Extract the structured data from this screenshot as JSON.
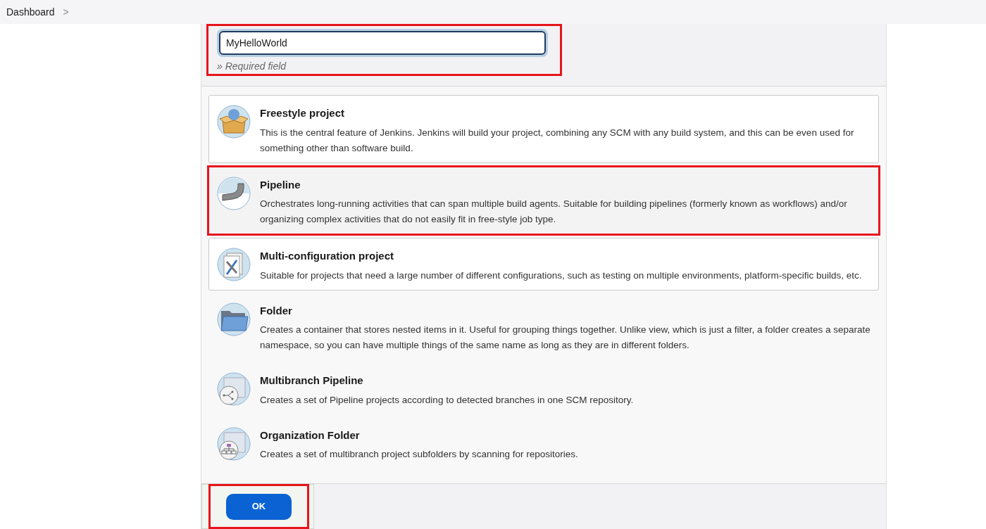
{
  "breadcrumb": {
    "label": "Dashboard",
    "separator": ">"
  },
  "name_field": {
    "value": "MyHelloWorld",
    "hint": "» Required field",
    "annotated": true
  },
  "items": [
    {
      "title": "Freestyle project",
      "description": "This is the central feature of Jenkins. Jenkins will build your project, combining any SCM with any build system, and this can be even used for something other than software build.",
      "kind": "bordered",
      "annotated": false
    },
    {
      "title": "Pipeline",
      "description": "Orchestrates long-running activities that can span multiple build agents. Suitable for building pipelines (formerly known as workflows) and/or organizing complex activities that do not easily fit in free-style job type.",
      "kind": "plain",
      "annotated": true
    },
    {
      "title": "Multi-configuration project",
      "description": "Suitable for projects that need a large number of different configurations, such as testing on multiple environments, platform-specific builds, etc.",
      "kind": "bordered",
      "annotated": false
    },
    {
      "title": "Folder",
      "description": "Creates a container that stores nested items in it. Useful for grouping things together. Unlike view, which is just a filter, a folder creates a separate namespace, so you can have multiple things of the same name as long as they are in different folders.",
      "kind": "plain",
      "annotated": false
    },
    {
      "title": "Multibranch Pipeline",
      "description": "Creates a set of Pipeline projects according to detected branches in one SCM repository.",
      "kind": "plain",
      "annotated": false
    },
    {
      "title": "Organization Folder",
      "description": "Creates a set of multibranch project subfolders by scanning for repositories.",
      "kind": "plain",
      "annotated": false
    }
  ],
  "ok_button": {
    "label": "OK",
    "annotated": true
  }
}
